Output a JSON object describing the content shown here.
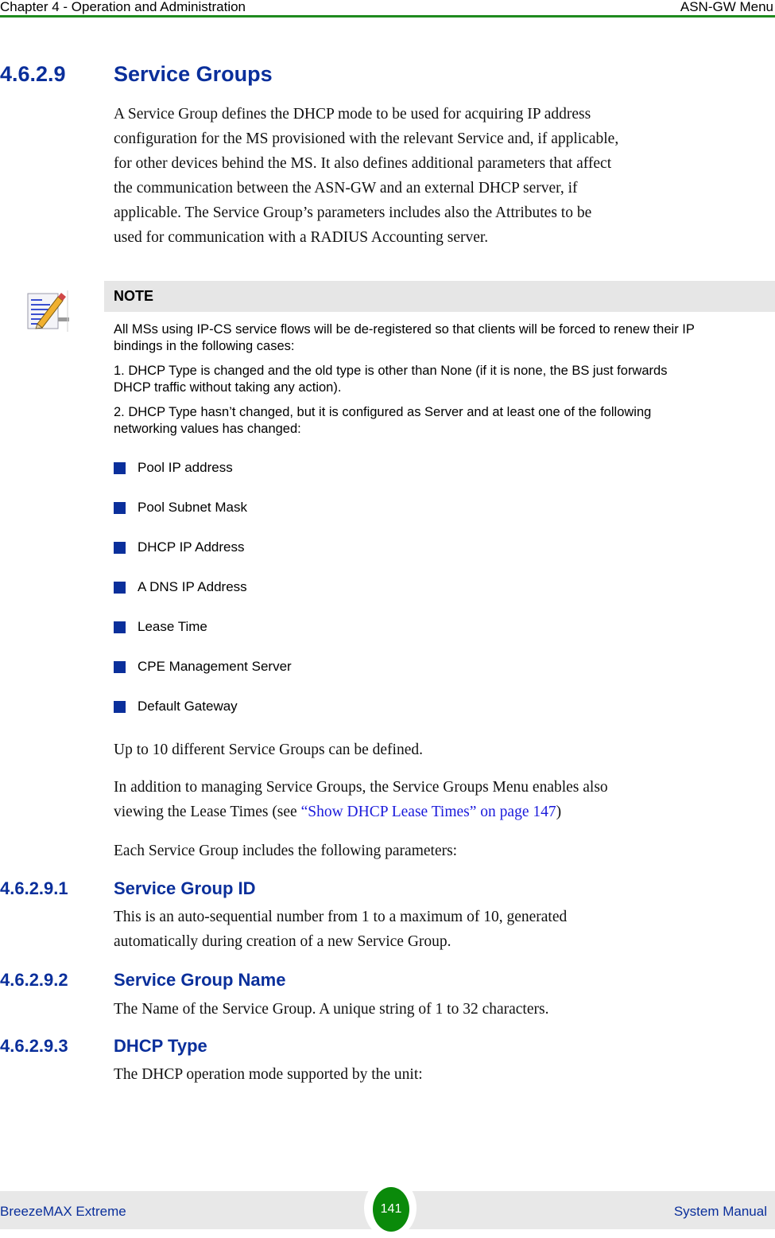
{
  "header": {
    "chapter": "Chapter 4 - Operation and Administration",
    "section": "ASN-GW Menu"
  },
  "section_heading": {
    "number": "4.6.2.9",
    "title": "Service Groups"
  },
  "intro_paragraph": [
    "A Service Group defines the DHCP mode to be used for acquiring IP address",
    "configuration for the MS provisioned with the relevant Service and, if applicable,",
    "for other devices behind the MS. It also defines additional parameters that affect",
    "the communication between the ASN-GW and an external DHCP server, if",
    "applicable. The Service Group’s parameters includes also the Attributes to be",
    "used for communication with a RADIUS Accounting server."
  ],
  "note": {
    "label": "NOTE",
    "icon": "note-pencil-icon",
    "para1": [
      "All MSs using IP-CS service flows will be de-registered so that clients will be forced to renew their IP",
      "bindings in the following cases:"
    ],
    "para2": [
      "1. DHCP Type is changed and the old type is other than None (if it is none, the BS just forwards",
      "DHCP traffic without taking any action)."
    ],
    "para3": [
      "2. DHCP Type hasn’t changed, but it is configured as Server and at least one of the following",
      "networking values has changed:"
    ],
    "bullets": [
      "Pool IP address",
      "Pool Subnet Mask",
      "DHCP IP Address",
      "A DNS IP Address",
      "Lease Time",
      "CPE Management Server",
      "Default Gateway"
    ]
  },
  "para_limit": "Up to 10 different Service Groups can be defined.",
  "para_lease": {
    "line1": "In addition to managing Service Groups, the Service Groups Menu enables also",
    "line2_prefix": "viewing the Lease Times (see ",
    "link_text": "“Show DHCP Lease Times” on page 147",
    "line2_suffix": ")"
  },
  "para_params": "Each Service Group includes the following parameters:",
  "subsections": [
    {
      "number": "4.6.2.9.1",
      "title": "Service Group ID",
      "lines": [
        "This is an auto-sequential number from 1 to a maximum of 10, generated",
        "automatically during creation of a new Service Group."
      ]
    },
    {
      "number": "4.6.2.9.2",
      "title": "Service Group Name",
      "lines": [
        "The Name of the Service Group. A unique string of 1 to 32 characters."
      ]
    },
    {
      "number": "4.6.2.9.3",
      "title": "DHCP Type",
      "lines": [
        "The DHCP operation mode supported by the unit:"
      ]
    }
  ],
  "footer": {
    "product": "BreezeMAX Extreme",
    "page_number": "141",
    "doc": "System Manual"
  },
  "colors": {
    "heading_blue": "#0a2f9b",
    "header_rule_green": "#1e8a1e",
    "page_badge_green": "#0a8a0a",
    "note_bar_gray": "#e6e6e6",
    "link_blue": "#1a1adb"
  }
}
